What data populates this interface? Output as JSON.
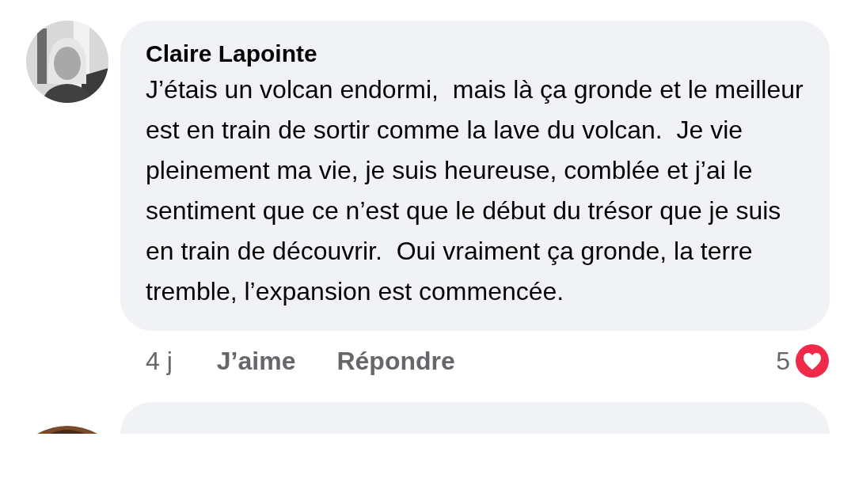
{
  "comment": {
    "author": "Claire Lapointe",
    "text": "J’étais un volcan endormi,  mais là ça gronde et le meilleur est en train de sortir comme la lave du volcan.  Je vie pleinement ma vie, je suis heureuse, comblée et j’ai le sentiment que ce n’est que le début du trésor que je suis en train de découvrir.  Oui vraiment ça gronde, la terre tremble, l’expansion est commencée.",
    "time": "4 j",
    "like": "J’aime",
    "reply": "Répondre",
    "reaction_count": "5"
  }
}
